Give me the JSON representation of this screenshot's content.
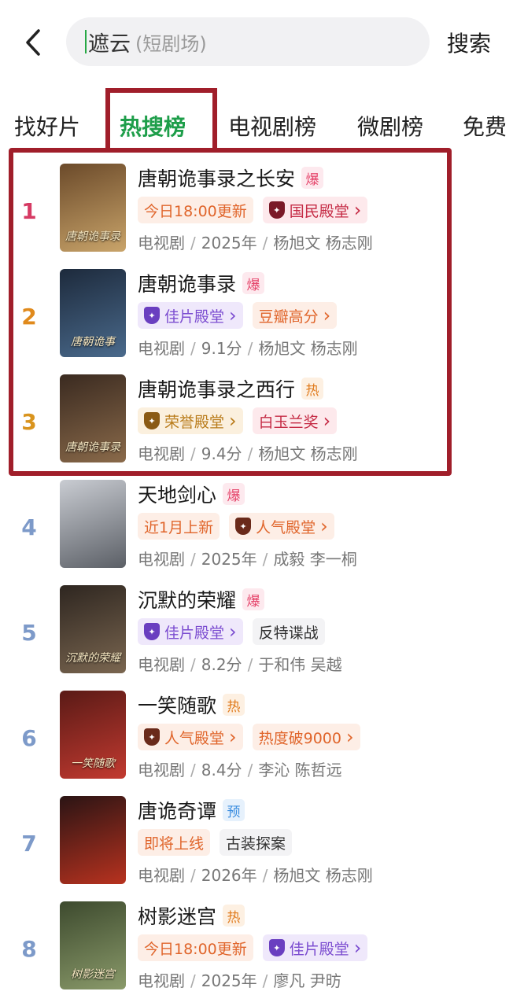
{
  "search": {
    "main_text": "遮云",
    "sub_text": "(短剧场)",
    "button_label": "搜索"
  },
  "tabs": [
    {
      "label": "找好片",
      "active": false
    },
    {
      "label": "热搜榜",
      "active": true
    },
    {
      "label": "电视剧榜",
      "active": false
    },
    {
      "label": "微剧榜",
      "active": false
    },
    {
      "label": "免费",
      "active": false
    }
  ],
  "colors": {
    "accent": "#1e9e4a",
    "highlight_border": "#a01e2a",
    "rank_top": [
      "#d63a63",
      "#e08a1c",
      "#d9941e"
    ],
    "rank_other": "#7d9ac9"
  },
  "items": [
    {
      "rank": "1",
      "title": "唐朝诡事录之长安",
      "badge": "爆",
      "tags": [
        {
          "label": "今日18:00更新",
          "style": "orange",
          "icon": "",
          "chevron": false
        },
        {
          "label": "国民殿堂",
          "style": "red",
          "icon": "shield-icon",
          "chevron": true
        }
      ],
      "meta": [
        "电视剧",
        "2025年",
        "杨旭文 杨志刚"
      ]
    },
    {
      "rank": "2",
      "title": "唐朝诡事录",
      "badge": "爆",
      "tags": [
        {
          "label": "佳片殿堂",
          "style": "purple",
          "icon": "shield-icon",
          "chevron": true
        },
        {
          "label": "豆瓣高分",
          "style": "orange",
          "icon": "",
          "chevron": true
        }
      ],
      "meta": [
        "电视剧",
        "9.1分",
        "杨旭文 杨志刚"
      ]
    },
    {
      "rank": "3",
      "title": "唐朝诡事录之西行",
      "badge": "热",
      "tags": [
        {
          "label": "荣誉殿堂",
          "style": "gold",
          "icon": "shield-icon",
          "chevron": true
        },
        {
          "label": "白玉兰奖",
          "style": "red",
          "icon": "",
          "chevron": true
        }
      ],
      "meta": [
        "电视剧",
        "9.4分",
        "杨旭文 杨志刚"
      ]
    },
    {
      "rank": "4",
      "title": "天地剑心",
      "badge": "爆",
      "tags": [
        {
          "label": "近1月上新",
          "style": "orange",
          "icon": "",
          "chevron": false
        },
        {
          "label": "人气殿堂",
          "style": "orange",
          "icon": "shield-icon",
          "chevron": true
        }
      ],
      "meta": [
        "电视剧",
        "2025年",
        "成毅 李一桐"
      ]
    },
    {
      "rank": "5",
      "title": "沉默的荣耀",
      "badge": "爆",
      "tags": [
        {
          "label": "佳片殿堂",
          "style": "purple",
          "icon": "shield-icon",
          "chevron": true
        },
        {
          "label": "反特谍战",
          "style": "gray",
          "icon": "",
          "chevron": false
        }
      ],
      "meta": [
        "电视剧",
        "8.2分",
        "于和伟 吴越"
      ]
    },
    {
      "rank": "6",
      "title": "一笑随歌",
      "badge": "热",
      "tags": [
        {
          "label": "人气殿堂",
          "style": "orange",
          "icon": "shield-icon",
          "chevron": true
        },
        {
          "label": "热度破9000",
          "style": "orange",
          "icon": "",
          "chevron": true
        }
      ],
      "meta": [
        "电视剧",
        "8.4分",
        "李沁 陈哲远"
      ]
    },
    {
      "rank": "7",
      "title": "唐诡奇谭",
      "badge": "预",
      "tags": [
        {
          "label": "即将上线",
          "style": "orange",
          "icon": "",
          "chevron": false
        },
        {
          "label": "古装探案",
          "style": "gray",
          "icon": "",
          "chevron": false
        }
      ],
      "meta": [
        "电视剧",
        "2026年",
        "杨旭文 杨志刚"
      ]
    },
    {
      "rank": "8",
      "title": "树影迷宫",
      "badge": "热",
      "tags": [
        {
          "label": "今日18:00更新",
          "style": "orange",
          "icon": "",
          "chevron": false
        },
        {
          "label": "佳片殿堂",
          "style": "purple",
          "icon": "shield-icon",
          "chevron": true
        }
      ],
      "meta": [
        "电视剧",
        "2025年",
        "廖凡 尹昉"
      ]
    }
  ],
  "posters": [
    {
      "caption": "唐朝诡事录",
      "colors": [
        "#6b4a2a",
        "#c9a46a"
      ]
    },
    {
      "caption": "唐朝诡事",
      "colors": [
        "#1d2a3c",
        "#4a6a8c"
      ]
    },
    {
      "caption": "唐朝诡事录",
      "colors": [
        "#3a2a20",
        "#8a6a4a"
      ]
    },
    {
      "caption": "",
      "colors": [
        "#c9ccd2",
        "#5b5f66"
      ]
    },
    {
      "caption": "沉默的荣耀",
      "colors": [
        "#2e2620",
        "#7a6650"
      ]
    },
    {
      "caption": "一笑随歌",
      "colors": [
        "#5a1a16",
        "#c23a30"
      ]
    },
    {
      "caption": "",
      "colors": [
        "#2a1414",
        "#b8321f"
      ]
    },
    {
      "caption": "树影迷宫",
      "colors": [
        "#3d4a2e",
        "#8a9a6a"
      ]
    }
  ]
}
